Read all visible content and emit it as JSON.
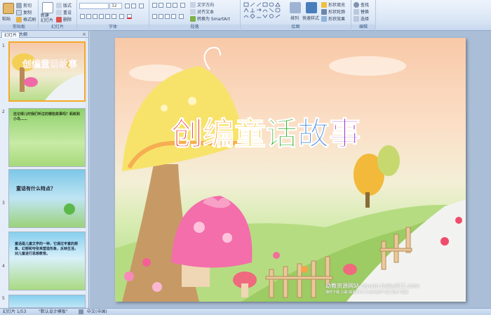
{
  "ribbon": {
    "clipboard": {
      "paste": "粘贴",
      "cut": "剪切",
      "copy": "复制",
      "format_painter": "格式刷",
      "label": "剪贴板"
    },
    "slides": {
      "new_slide": "新建\n幻灯片",
      "layout": "版式",
      "reset": "重设",
      "delete": "删除",
      "label": "幻灯片"
    },
    "font": {
      "font_size": "32",
      "label": "字体"
    },
    "paragraph": {
      "text_direction": "文字方向",
      "align_text": "对齐文本",
      "smartart": "转换为 SmartArt",
      "label": "段落"
    },
    "drawing": {
      "arrange": "排列",
      "quick_styles": "快速样式",
      "shape_fill": "形状填充",
      "shape_outline": "形状轮廓",
      "shape_effects": "形状效果",
      "label": "绘图"
    },
    "editing": {
      "find": "查找",
      "replace": "替换",
      "select": "选择",
      "label": "编辑"
    }
  },
  "panel": {
    "tab_slides": "幻灯片",
    "tab_outline": "大纲",
    "close": "×",
    "thumbnails": [
      {
        "num": "1",
        "title": "创编童话故事"
      },
      {
        "num": "2",
        "text": "还记得儿时我们听过的哪些故事吗？蚂蚁和小鸟……"
      },
      {
        "num": "3",
        "text": "童话有什么特点？"
      },
      {
        "num": "4",
        "text": "童话是儿童文学的一种，它通过丰富的想象、幻想和夸张来塑造形象，反映生活，对儿童进行思想教育。"
      },
      {
        "num": "5",
        "text": ""
      }
    ]
  },
  "slide": {
    "title_chars": [
      "创",
      "编",
      "童",
      "话",
      "故",
      "事"
    ],
    "title_colors": [
      "#e8221f",
      "#ff8a00",
      "#f2c400",
      "#2db12a",
      "#2f7de1",
      "#9b2fc9"
    ],
    "watermark_line1": "幼教资源网站  ziyuan.baby611.com",
    "watermark_line2": "课件下载  儿歌  故事MP3  FLASH课件下载  试卷下载等"
  },
  "status": {
    "slide_pos": "幻灯片 1/53",
    "theme": "\"默认设计模板\"",
    "lang": "中文(中国)"
  }
}
